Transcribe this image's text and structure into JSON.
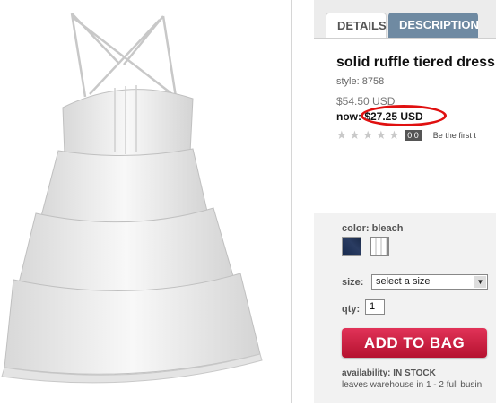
{
  "tabs": {
    "details": "DETAILS",
    "description": "DESCRIPTION"
  },
  "product": {
    "title": "solid ruffle tiered dress",
    "style": "style: 8758",
    "original_price": "$54.50 USD",
    "now_label": "now",
    "now_price": ": $27.25 USD"
  },
  "rating": {
    "stars": 0,
    "max_stars": 5,
    "score": "0.0",
    "first_review_text": "Be the first t"
  },
  "options": {
    "color_label": "color: bleach",
    "swatches": [
      {
        "name": "navy",
        "color": "#172a4e"
      },
      {
        "name": "bleach",
        "color": "#ffffff"
      }
    ],
    "size_label": "size:",
    "size_placeholder": "select a size",
    "qty_label": "qty:",
    "qty_value": "1",
    "add_to_bag": "ADD TO BAG",
    "availability": "availability: IN STOCK",
    "leaves_warehouse": "leaves warehouse in 1 - 2 full busin"
  },
  "colors": {
    "accent_tab": "#6f8aa2",
    "button": "#c71d40",
    "highlight_circle": "#e01010"
  }
}
